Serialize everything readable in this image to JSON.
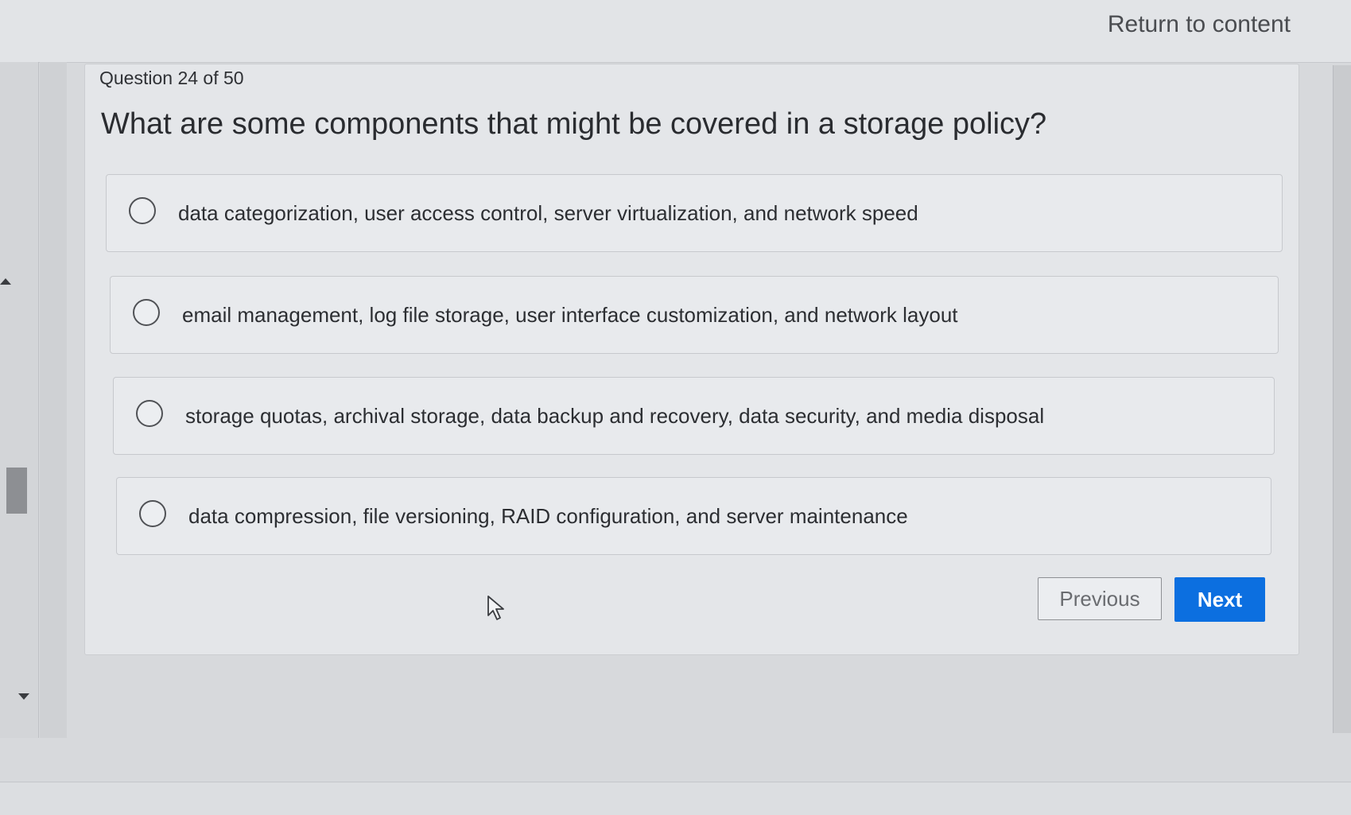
{
  "header": {
    "return_link": "Return to content"
  },
  "question": {
    "counter": "Question 24 of 50",
    "text": "What are some components that might be covered in a storage policy?",
    "options": [
      {
        "label": "data categorization, user access control, server virtualization, and network speed"
      },
      {
        "label": "email management, log file storage, user interface customization, and network layout"
      },
      {
        "label": "storage quotas, archival storage, data backup and recovery, data security, and media disposal"
      },
      {
        "label": "data compression, file versioning, RAID configuration, and server maintenance"
      }
    ]
  },
  "nav": {
    "previous_label": "Previous",
    "next_label": "Next"
  },
  "colors": {
    "accent": "#0c6fe0",
    "background": "#d7d9dc",
    "card": "#e4e6e9"
  },
  "icons": {
    "radio": "radio-unselected-icon",
    "cursor": "mouse-pointer-icon",
    "scroll_up": "scroll-up-arrow-icon",
    "scroll_down": "scroll-down-arrow-icon"
  }
}
